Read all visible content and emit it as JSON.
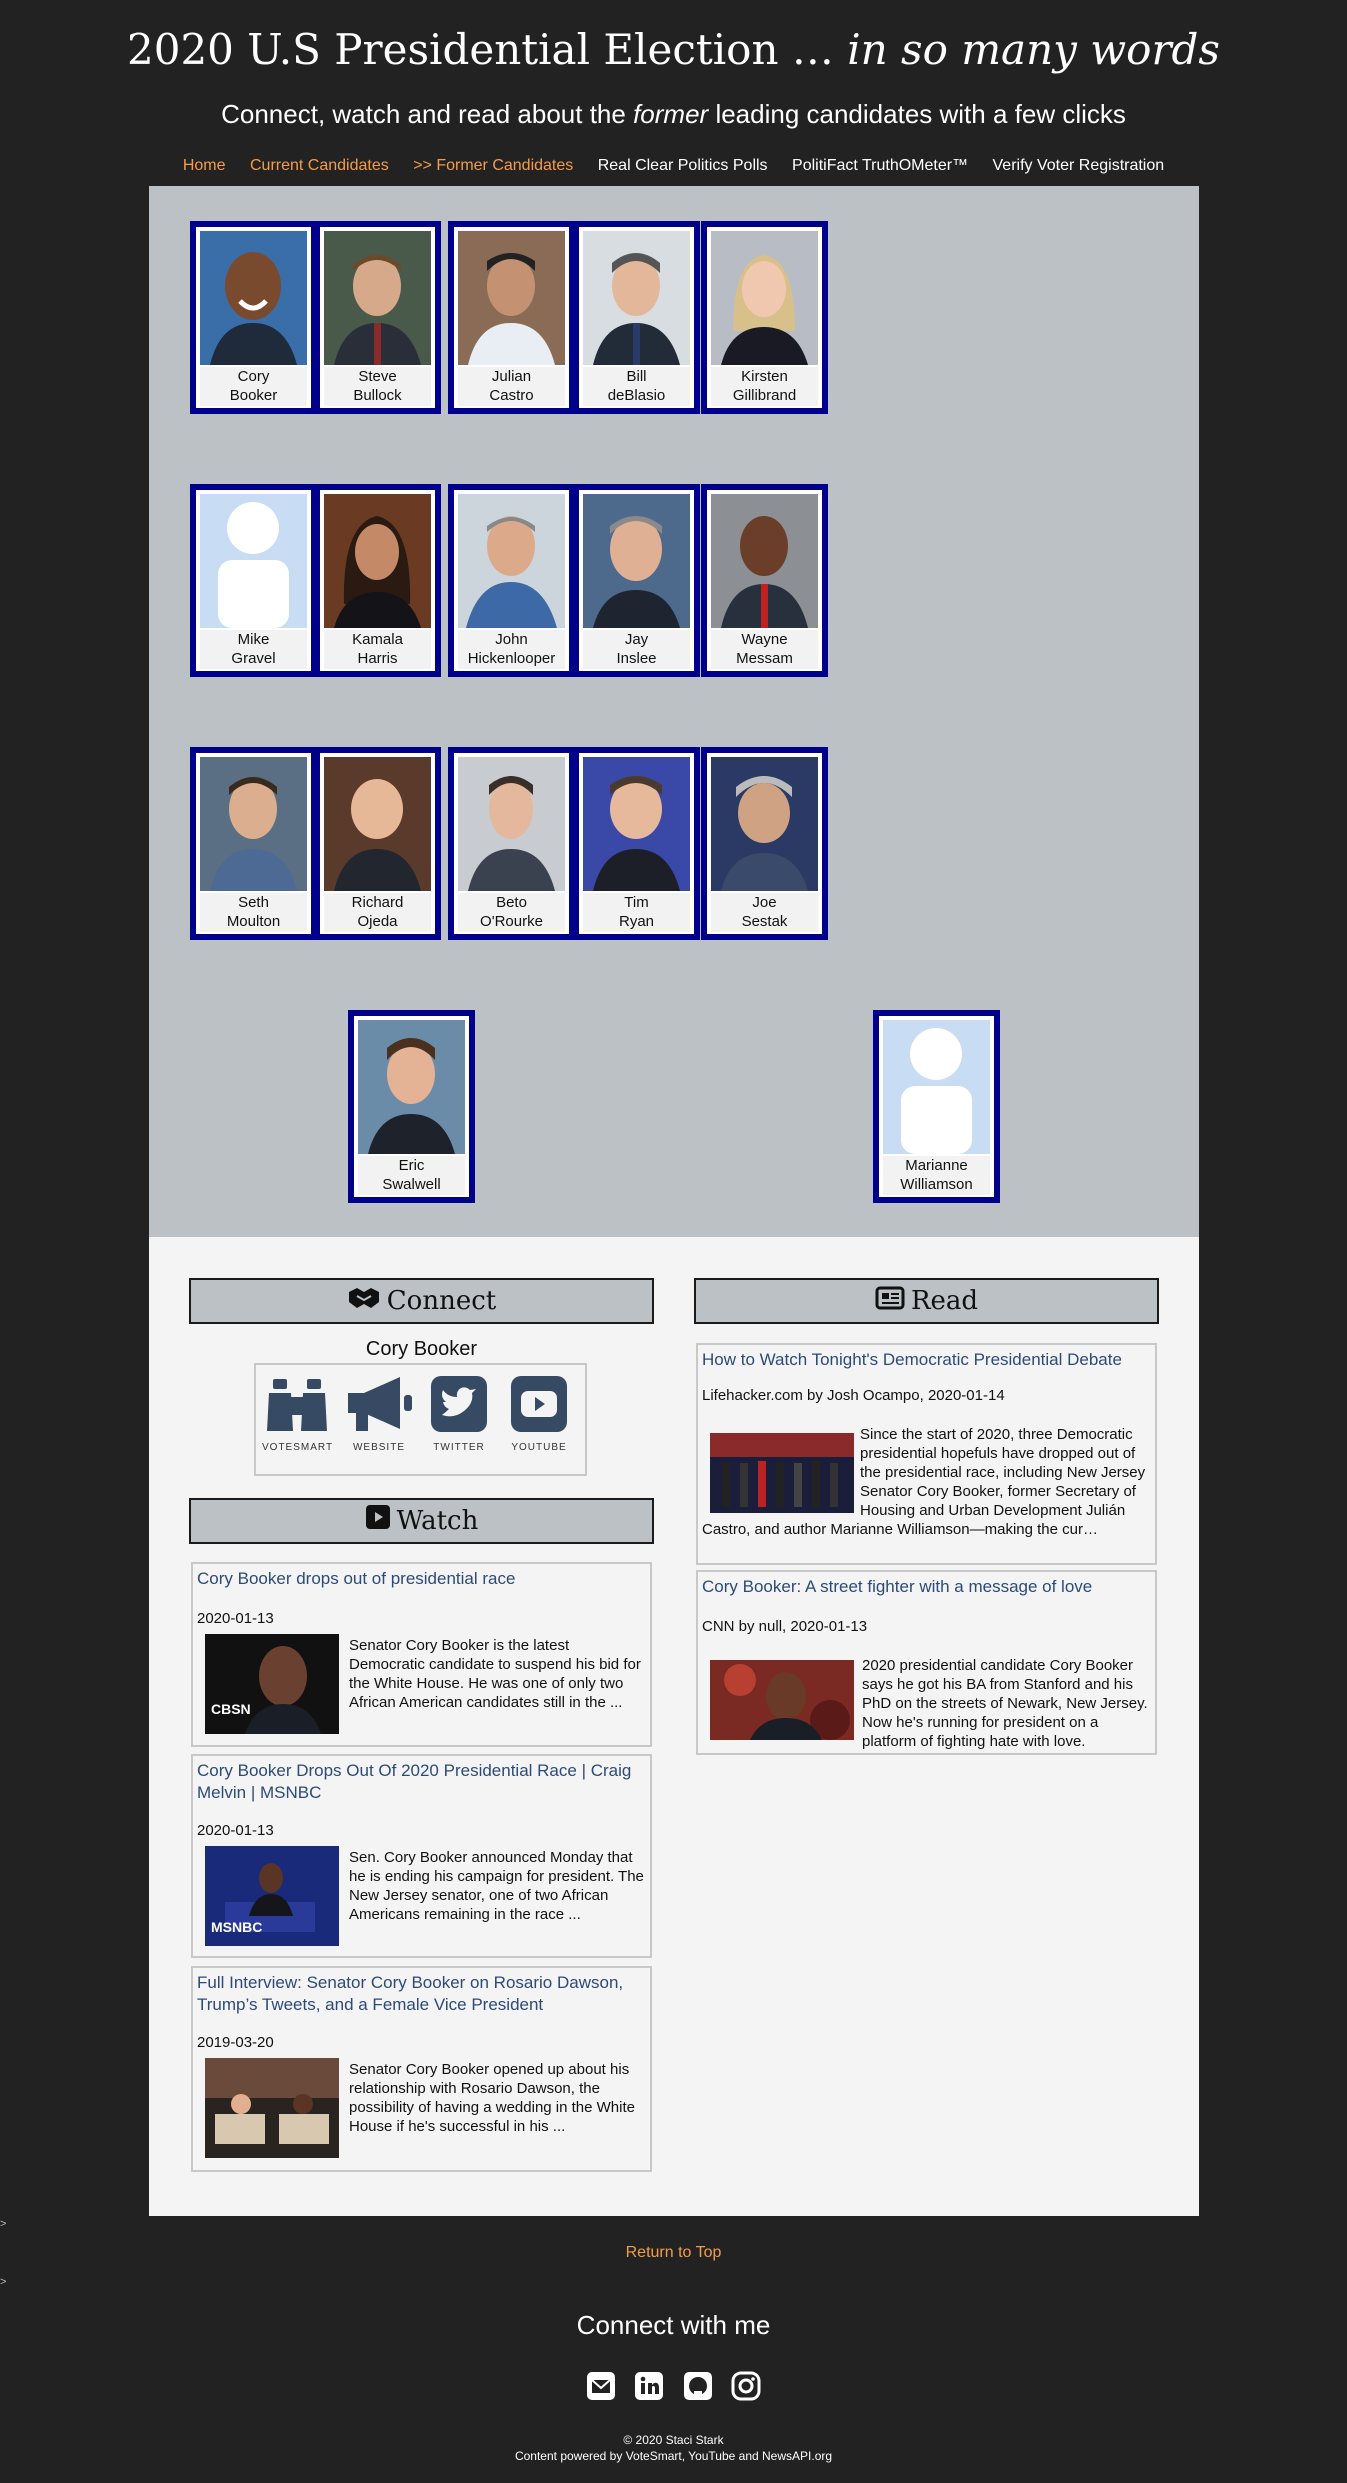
{
  "header": {
    "title_main": "2020 U.S Presidential Election …",
    "title_em": "in so many words",
    "subtitle_pre": "Connect, watch and read about the",
    "subtitle_em": "former",
    "subtitle_post": "leading candidates with a few clicks"
  },
  "nav": [
    {
      "label": "Home",
      "color": "orange"
    },
    {
      "label": "Current Candidates",
      "color": "orange"
    },
    {
      "label": ">> Former Candidates",
      "color": "orange"
    },
    {
      "label": "Real Clear Politics Polls",
      "color": "white"
    },
    {
      "label": "PolitiFact TruthOMeter™",
      "color": "white"
    },
    {
      "label": "Verify Voter Registration",
      "color": "white"
    }
  ],
  "candidates": [
    {
      "first": "Cory",
      "last": "Booker"
    },
    {
      "first": "Steve",
      "last": "Bullock"
    },
    {
      "first": "Julian",
      "last": "Castro"
    },
    {
      "first": "Bill",
      "last": "deBlasio"
    },
    {
      "first": "Kirsten",
      "last": "Gillibrand"
    },
    {
      "first": "Mike",
      "last": "Gravel"
    },
    {
      "first": "Kamala",
      "last": "Harris"
    },
    {
      "first": "John",
      "last": "Hickenlooper"
    },
    {
      "first": "Jay",
      "last": "Inslee"
    },
    {
      "first": "Wayne",
      "last": "Messam"
    },
    {
      "first": "Seth",
      "last": "Moulton"
    },
    {
      "first": "Richard",
      "last": "Ojeda"
    },
    {
      "first": "Beto",
      "last": "O'Rourke"
    },
    {
      "first": "Tim",
      "last": "Ryan"
    },
    {
      "first": "Joe",
      "last": "Sestak"
    },
    {
      "first": "Eric",
      "last": "Swalwell"
    },
    {
      "first": "Marianne",
      "last": "Williamson"
    }
  ],
  "connect": {
    "heading": "Connect",
    "candidate_name": "Cory Booker",
    "links": [
      {
        "label": "VOTESMART",
        "icon": "binoculars-icon"
      },
      {
        "label": "WEBSITE",
        "icon": "megaphone-icon"
      },
      {
        "label": "TWITTER",
        "icon": "twitter-icon"
      },
      {
        "label": "YOUTUBE",
        "icon": "youtube-icon"
      }
    ]
  },
  "watch": {
    "heading": "Watch",
    "videos": [
      {
        "title": "Cory Booker drops out of presidential race",
        "date": "2020-01-13",
        "description": "Senator Cory Booker is the latest Democratic candidate to suspend his bid for the White House. He was one of only two African American candidates still in the ...",
        "thumb_text": "CBSN"
      },
      {
        "title": "Cory Booker Drops Out Of 2020 Presidential Race | Craig Melvin | MSNBC",
        "date": "2020-01-13",
        "description": "Sen. Cory Booker announced Monday that he is ending his campaign for president. The New Jersey senator, one of two African Americans remaining in the race ...",
        "thumb_text": "MSNBC"
      },
      {
        "title": "Full Interview: Senator Cory Booker on Rosario Dawson, Trump’s Tweets, and a Female Vice President",
        "date": "2019-03-20",
        "description": "Senator Cory Booker opened up about his relationship with Rosario Dawson, the possibility of having a wedding in the White House if he's successful in his ...",
        "thumb_text": ""
      }
    ]
  },
  "read": {
    "heading": "Read",
    "articles": [
      {
        "title": "How to Watch Tonight's Democratic Presidential Debate",
        "source": "Lifehacker.com by Josh Ocampo, 2020-01-14",
        "description": "Since the start of 2020, three Democratic presidential hopefuls have dropped out of the presidential race, including New Jersey Senator Cory Booker, former Secretary of Housing and Urban Development Julián Castro, and author Marianne Williamson—making the cur…"
      },
      {
        "title": "Cory Booker: A street fighter with a message of love",
        "source": "CNN by null, 2020-01-13",
        "description": "2020 presidential candidate Cory Booker says he got his BA from Stanford and his PhD on the streets of Newark, New Jersey. Now he's running for president on a platform of fighting hate with love."
      }
    ]
  },
  "footer": {
    "return_top": "Return to Top",
    "stray_1": ">",
    "stray_2": ">",
    "connect_me": "Connect with me",
    "social_icons": [
      "envelope-icon",
      "linkedin-icon",
      "github-icon",
      "instagram-icon"
    ],
    "copyright": "© 2020 Staci Stark",
    "powered_by": "Content powered by VoteSmart, YouTube and NewsAPI.org"
  },
  "colors": {
    "page_bg": "#222222",
    "accent_orange": "#f39c4a",
    "card_border": "#00008b",
    "gallery_bg": "#bcc1c6",
    "link_blue": "#2c4a7a"
  }
}
